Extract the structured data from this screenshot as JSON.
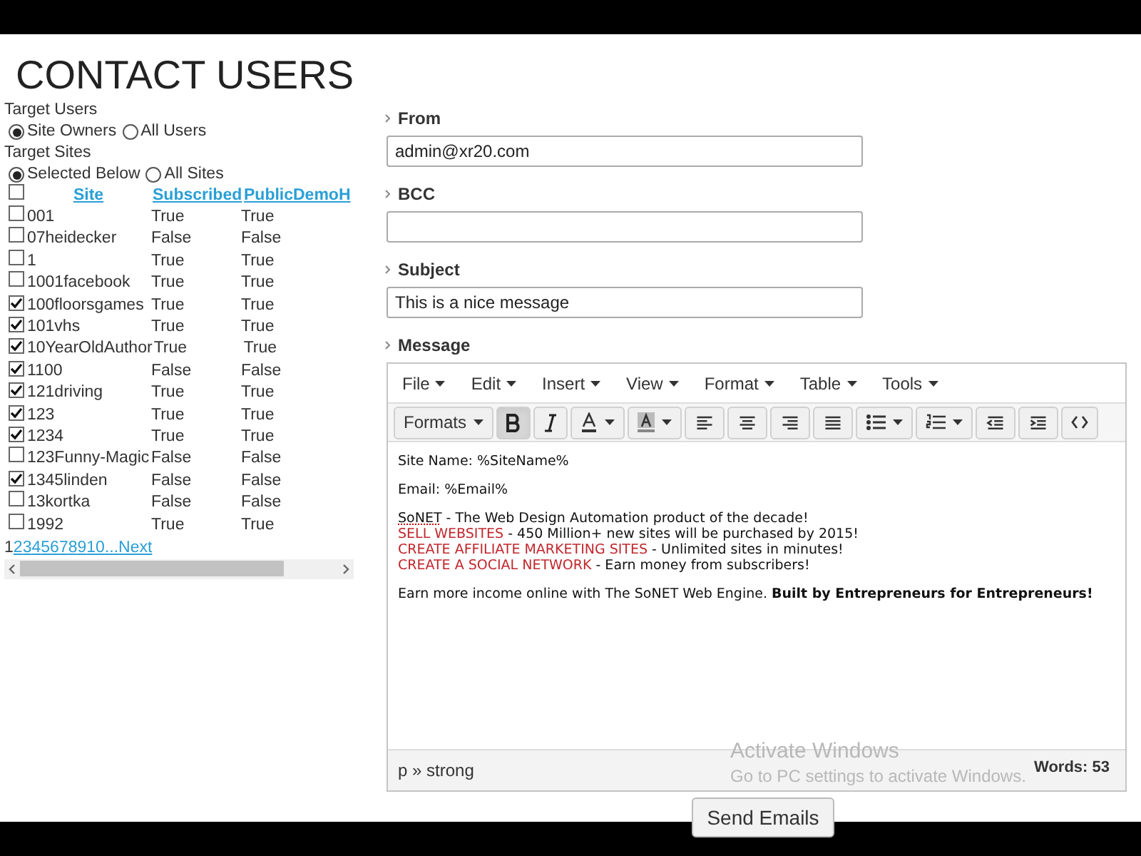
{
  "title": "CONTACT USERS",
  "target_users": {
    "label": "Target Users",
    "options": [
      {
        "label": "Site Owners",
        "selected": true
      },
      {
        "label": "All Users",
        "selected": false
      }
    ]
  },
  "target_sites": {
    "label": "Target Sites",
    "options": [
      {
        "label": "Selected Below",
        "selected": true
      },
      {
        "label": "All Sites",
        "selected": false
      }
    ]
  },
  "sites_table": {
    "select_all": false,
    "columns": [
      "Site",
      "Subscribed",
      "PublicDemoH"
    ],
    "rows": [
      {
        "site": "001",
        "subscribed": "True",
        "public_demo": "True",
        "checked": false
      },
      {
        "site": "07heidecker",
        "subscribed": "False",
        "public_demo": "False",
        "checked": false
      },
      {
        "site": "1",
        "subscribed": "True",
        "public_demo": "True",
        "checked": false
      },
      {
        "site": "1001facebook",
        "subscribed": "True",
        "public_demo": "True",
        "checked": false
      },
      {
        "site": "100floorsgames",
        "subscribed": "True",
        "public_demo": "True",
        "checked": true
      },
      {
        "site": "101vhs",
        "subscribed": "True",
        "public_demo": "True",
        "checked": true
      },
      {
        "site": "10YearOldAuthor",
        "subscribed": "True",
        "public_demo": "True",
        "checked": true
      },
      {
        "site": "1100",
        "subscribed": "False",
        "public_demo": "False",
        "checked": true
      },
      {
        "site": "121driving",
        "subscribed": "True",
        "public_demo": "True",
        "checked": true
      },
      {
        "site": "123",
        "subscribed": "True",
        "public_demo": "True",
        "checked": true
      },
      {
        "site": "1234",
        "subscribed": "True",
        "public_demo": "True",
        "checked": true
      },
      {
        "site": "123Funny-Magic",
        "subscribed": "False",
        "public_demo": "False",
        "checked": false
      },
      {
        "site": "1345linden",
        "subscribed": "False",
        "public_demo": "False",
        "checked": true
      },
      {
        "site": "13kortka",
        "subscribed": "False",
        "public_demo": "False",
        "checked": false
      },
      {
        "site": "1992",
        "subscribed": "True",
        "public_demo": "True",
        "checked": false
      }
    ],
    "pager": [
      {
        "label": "1",
        "selected": true
      },
      {
        "label": "2",
        "selected": false
      },
      {
        "label": "3",
        "selected": false
      },
      {
        "label": "4",
        "selected": false
      },
      {
        "label": "5",
        "selected": false
      },
      {
        "label": "6",
        "selected": false
      },
      {
        "label": "7",
        "selected": false
      },
      {
        "label": "8",
        "selected": false
      },
      {
        "label": "9",
        "selected": false
      },
      {
        "label": "10",
        "selected": false
      },
      {
        "label": "...",
        "selected": false
      },
      {
        "label": "Next",
        "selected": false
      }
    ]
  },
  "fields": [
    {
      "label": "From",
      "value": "admin@xr20.com"
    },
    {
      "label": "BCC"
    },
    {
      "label": "Subject",
      "value": "This is a nice message"
    }
  ],
  "message": {
    "label": "Message",
    "menu": [
      "File",
      "Edit",
      "Insert",
      "View",
      "Format",
      "Table",
      "Tools"
    ],
    "toolbar": [
      {
        "kind": "formats",
        "label": "Formats",
        "selected": false
      },
      {
        "kind": "bold",
        "selected": true
      },
      {
        "kind": "italic",
        "selected": false
      },
      {
        "kind": "text-color",
        "selected": false
      },
      {
        "kind": "bg-color",
        "selected": false
      },
      {
        "kind": "align-left",
        "selected": false
      },
      {
        "kind": "align-center",
        "selected": false
      },
      {
        "kind": "align-right",
        "selected": false
      },
      {
        "kind": "justify",
        "selected": false
      },
      {
        "kind": "bullets",
        "selected": false
      },
      {
        "kind": "numbers",
        "selected": false
      },
      {
        "kind": "outdent",
        "selected": false
      },
      {
        "kind": "indent",
        "selected": false
      },
      {
        "kind": "code",
        "selected": false
      }
    ],
    "paragraphs": [
      [
        {
          "text": "Site Name: %SiteName%"
        }
      ],
      [
        {
          "text": "Email: %Email%"
        }
      ],
      [
        {
          "lead": "SoNET",
          "kind": "misspelled",
          "text": " - The Web Design Automation product of the decade!"
        },
        {
          "lead": "SELL WEBSITES",
          "kind": "link",
          "text": " - 450 Million+ new sites will be purchased by 2015!"
        },
        {
          "lead": "CREATE AFFILIATE MARKETING SITES",
          "kind": "link",
          "text": " - Unlimited sites in minutes!"
        },
        {
          "lead": "CREATE A SOCIAL NETWORK",
          "kind": "link",
          "text": " - Earn money from subscribers!"
        }
      ],
      [
        {
          "text": "Earn more income online with The SoNET Web Engine. **Built by Entrepreneurs for Entrepreneurs!**"
        }
      ]
    ],
    "path": "p » strong",
    "word_count": "Words: 53"
  },
  "watermark": {
    "title": "Activate Windows",
    "subtitle": "Go to PC settings to activate Windows."
  },
  "send_button": "Send Emails"
}
